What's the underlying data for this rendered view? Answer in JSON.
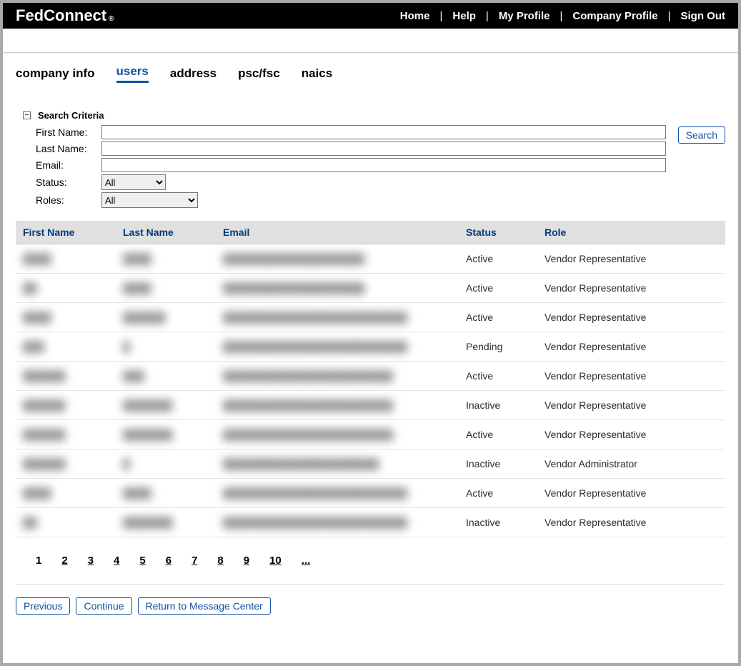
{
  "logo": {
    "main": "FedConnect",
    "sub": "®"
  },
  "topnav": [
    "Home",
    "Help",
    "My Profile",
    "Company Profile",
    "Sign Out"
  ],
  "tabs": [
    {
      "key": "company-info",
      "label": "company info",
      "active": false
    },
    {
      "key": "users",
      "label": "users",
      "active": true
    },
    {
      "key": "address",
      "label": "address",
      "active": false
    },
    {
      "key": "pscfsc",
      "label": "psc/fsc",
      "active": false
    },
    {
      "key": "naics",
      "label": "naics",
      "active": false
    }
  ],
  "search": {
    "header": "Search Criteria",
    "collapse_glyph": "−",
    "first_name_label": "First Name:",
    "last_name_label": "Last Name:",
    "email_label": "Email:",
    "status_label": "Status:",
    "roles_label": "Roles:",
    "first_name_value": "",
    "last_name_value": "",
    "email_value": "",
    "status_selected": "All",
    "roles_selected": "All",
    "search_button": "Search"
  },
  "table": {
    "columns": [
      "First Name",
      "Last Name",
      "Email",
      "Status",
      "Role"
    ],
    "rows": [
      {
        "first": "████",
        "last": "████",
        "email": "████████████████████",
        "status": "Active",
        "role": "Vendor Representative"
      },
      {
        "first": "██",
        "last": "████",
        "email": "████████████████████",
        "status": "Active",
        "role": "Vendor Representative"
      },
      {
        "first": "████",
        "last": "██████",
        "email": "██████████████████████████",
        "status": "Active",
        "role": "Vendor Representative"
      },
      {
        "first": "███",
        "last": "█",
        "email": "██████████████████████████",
        "status": "Pending",
        "role": "Vendor Representative"
      },
      {
        "first": "██████",
        "last": "███",
        "email": "████████████████████████",
        "status": "Active",
        "role": "Vendor Representative"
      },
      {
        "first": "██████",
        "last": "███████",
        "email": "████████████████████████",
        "status": "Inactive",
        "role": "Vendor Representative"
      },
      {
        "first": "██████",
        "last": "███████",
        "email": "████████████████████████",
        "status": "Active",
        "role": "Vendor Representative"
      },
      {
        "first": "██████",
        "last": "█",
        "email": "██████████████████████",
        "status": "Inactive",
        "role": "Vendor Administrator"
      },
      {
        "first": "████",
        "last": "████",
        "email": "██████████████████████████",
        "status": "Active",
        "role": "Vendor Representative"
      },
      {
        "first": "██",
        "last": "███████",
        "email": "██████████████████████████",
        "status": "Inactive",
        "role": "Vendor Representative"
      }
    ]
  },
  "pager": {
    "pages": [
      "1",
      "2",
      "3",
      "4",
      "5",
      "6",
      "7",
      "8",
      "9",
      "10",
      "..."
    ],
    "current": "1"
  },
  "actions": {
    "previous": "Previous",
    "continue": "Continue",
    "return": "Return to Message Center"
  }
}
